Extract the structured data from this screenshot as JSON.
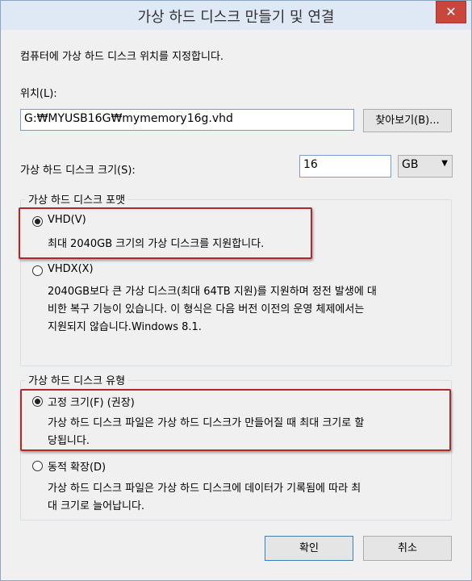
{
  "window": {
    "title": "가상 하드 디스크 만들기 및 연결",
    "close_symbol": "✕"
  },
  "intro": "컴퓨터에 가상 하드 디스크 위치를 지정합니다.",
  "location": {
    "label": "위치(L):",
    "value": "G:₩MYUSB16G₩mymemory16g.vhd",
    "browse_label": "찾아보기(B)..."
  },
  "size": {
    "label": "가상 하드 디스크 크기(S):",
    "value": "16",
    "unit": "GB",
    "arrow": "▼"
  },
  "format_group": {
    "title": "가상 하드 디스크 포맷",
    "options": [
      {
        "label": "VHD(V)",
        "desc": "최대 2040GB 크기의 가상 디스크를 지원합니다.",
        "checked": true
      },
      {
        "label": "VHDX(X)",
        "desc_lines": [
          "2040GB보다 큰 가상 디스크(최대 64TB 지원)를 지원하며 정전 발생에 대",
          "비한 복구 기능이 있습니다. 이 형식은 다음 버전 이전의 운영 체제에서는",
          "지원되지 않습니다.Windows 8.1."
        ],
        "checked": false
      }
    ]
  },
  "type_group": {
    "title": "가상 하드 디스크 유형",
    "options": [
      {
        "label": "고정 크기(F) (권장)",
        "desc_lines": [
          "가상 하드 디스크 파일은 가상 하드 디스크가 만들어질 때 최대 크기로 할",
          "당됩니다."
        ],
        "checked": true
      },
      {
        "label": "동적 확장(D)",
        "desc_lines": [
          "가상 하드 디스크 파일은 가상 하드 디스크에 데이터가 기록됨에 따라 최",
          "대 크기로 늘어납니다."
        ],
        "checked": false
      }
    ]
  },
  "buttons": {
    "ok": "확인",
    "cancel": "취소"
  },
  "colors": {
    "highlight": "#b02a2a",
    "close": "#c9463d",
    "titlebar": "#dfe9f5"
  }
}
